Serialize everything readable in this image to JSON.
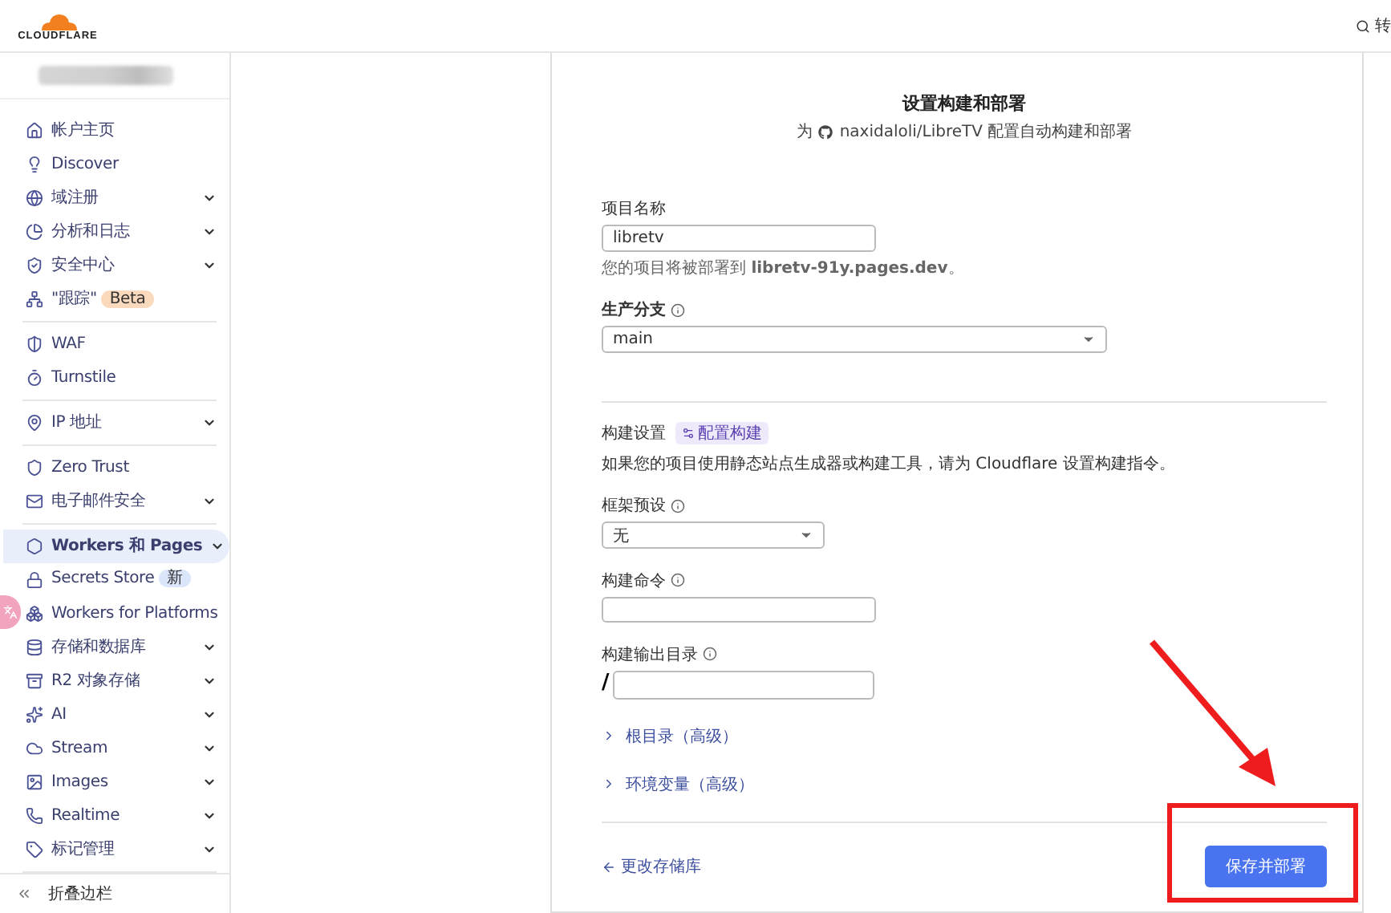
{
  "header": {
    "logo_text": "CLOUDFLARE",
    "search_label": "转"
  },
  "sidebar": {
    "sections": [
      [
        {
          "label": "帐户主页",
          "has_menu": false,
          "selected": false
        },
        {
          "label": "Discover",
          "has_menu": false,
          "selected": false
        },
        {
          "label": "域注册",
          "has_menu": true,
          "selected": false
        },
        {
          "label": "分析和日志",
          "has_menu": true,
          "selected": false
        },
        {
          "label": "安全中心",
          "has_menu": true,
          "selected": false
        },
        {
          "label": "\"跟踪\"",
          "has_menu": false,
          "selected": false,
          "badge": "Beta",
          "color": "#fbd9bd"
        }
      ],
      [
        {
          "label": "WAF",
          "has_menu": false,
          "selected": false
        },
        {
          "label": "Turnstile",
          "has_menu": false,
          "selected": false
        }
      ],
      [
        {
          "label": "IP 地址",
          "has_menu": true,
          "selected": false
        }
      ],
      [
        {
          "label": "Zero Trust",
          "has_menu": false,
          "selected": false
        },
        {
          "label": "电子邮件安全",
          "has_menu": true,
          "selected": false
        }
      ],
      [
        {
          "label": "Workers 和 Pages",
          "has_menu": true,
          "selected": true
        },
        {
          "label": "Secrets Store",
          "has_menu": false,
          "selected": false,
          "badge": "新",
          "color": "#dce6fb"
        },
        {
          "label": "Workers for Platforms",
          "has_menu": false,
          "selected": false
        },
        {
          "label": "存储和数据库",
          "has_menu": true,
          "selected": false
        },
        {
          "label": "R2 对象存储",
          "has_menu": true,
          "selected": false
        },
        {
          "label": "AI",
          "has_menu": true,
          "selected": false
        },
        {
          "label": "Stream",
          "has_menu": true,
          "selected": false
        },
        {
          "label": "Images",
          "has_menu": true,
          "selected": false
        },
        {
          "label": "Realtime",
          "has_menu": true,
          "selected": false
        },
        {
          "label": "标记管理",
          "has_menu": true,
          "selected": false
        }
      ]
    ],
    "collapse_label": "折叠边栏"
  },
  "form": {
    "title": "设置构建和部署",
    "subtitle_prefix": "为",
    "repo": "naxidaloli/LibreTV",
    "subtitle_suffix": "配置自动构建和部署",
    "project_name": {
      "label": "项目名称",
      "value": "libretv",
      "hint": "您的项目将被部署到 **libretv-91y.pages.dev**。"
    },
    "branch": {
      "label": "生产分支",
      "value": "main"
    },
    "build": {
      "heading": "构建设置",
      "badge": "配置构建",
      "description": "如果您的项目使用静态站点生成器或构建工具，请为 Cloudflare 设置构建指令。",
      "preset": {
        "label": "框架预设",
        "value": "无"
      },
      "command": {
        "label": "构建命令"
      },
      "output": {
        "label": "构建输出目录",
        "prefix": "/"
      }
    },
    "advanced": [
      {
        "label": "根目录（高级）",
        "expanded": false
      },
      {
        "label": "环境变量（高级）",
        "expanded": false
      }
    ],
    "back_link": "更改存储库",
    "submit": "保存并部署"
  }
}
